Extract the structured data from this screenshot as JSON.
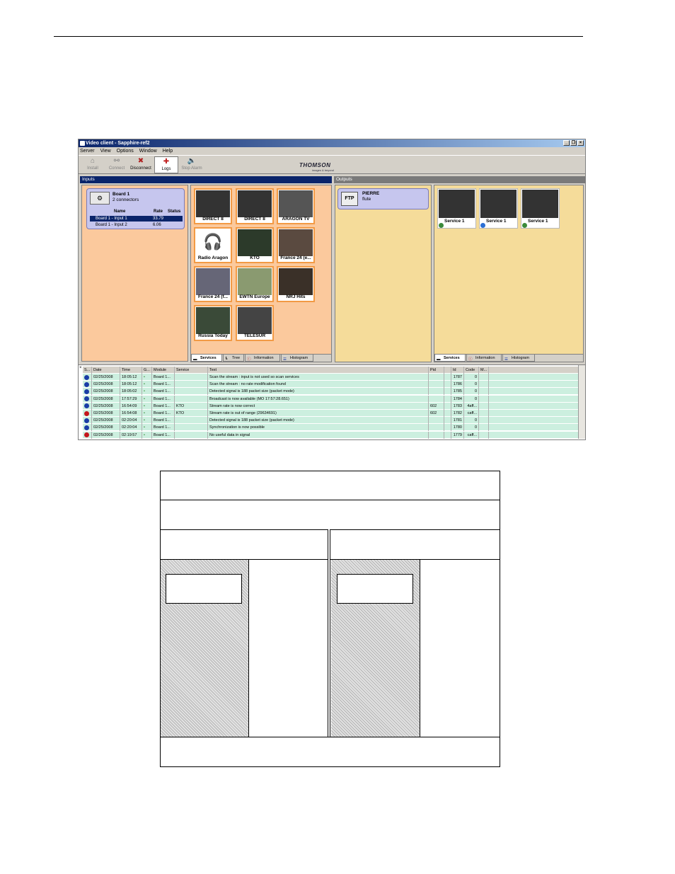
{
  "window": {
    "title": "Video client - Sapphire-ref2",
    "controls": [
      "_",
      "❐",
      "×"
    ]
  },
  "menu": [
    "Server",
    "View",
    "Options",
    "Window",
    "Help"
  ],
  "toolbar": {
    "buttons": [
      {
        "label": "Install",
        "icon": "install-icon",
        "state": "disabled"
      },
      {
        "label": "Connect",
        "icon": "connect-icon",
        "state": "disabled"
      },
      {
        "label": "Disconnect",
        "icon": "disconnect-icon",
        "state": "enabled"
      },
      {
        "label": "Logs",
        "icon": "logs-icon",
        "state": "active"
      },
      {
        "label": "Stop Alarm",
        "icon": "speaker-icon",
        "state": "disabled"
      }
    ],
    "brand": "THOMSON",
    "brand_tagline": "images & beyond"
  },
  "inputs": {
    "header": "Inputs",
    "board": {
      "title": "Board 1",
      "subtitle": "2 connectors",
      "columns": [
        "Name",
        "Rate",
        "Status"
      ],
      "rows": [
        {
          "name": "Board 1 - Input 1",
          "rate": "33.79",
          "status": "",
          "selected": true
        },
        {
          "name": "Board 1 - Input 2",
          "rate": "6.06",
          "status": "",
          "selected": false
        }
      ]
    },
    "services": [
      "DIRECT 8",
      "DIRECT 8",
      "ARAGON TV",
      "Radio Aragon",
      "KTO",
      "France 24 (e...",
      "France 24 (f...",
      "EWTN Europe",
      "NRJ Hits",
      "Russia Today",
      "TELESUR"
    ],
    "tabs": [
      "Services",
      "Tree",
      "Information",
      "Histogram"
    ]
  },
  "outputs": {
    "header": "Outputs",
    "destination": {
      "title": "PIERRE",
      "subtitle": "flute",
      "icon_label": "FTP"
    },
    "services": [
      "Service 1",
      "Service 1",
      "Service 1"
    ],
    "tabs": [
      "Services",
      "Information",
      "Histogram"
    ]
  },
  "logs": {
    "columns": [
      "S...",
      "Date",
      "Time",
      "G...",
      "Module",
      "Service",
      "Text",
      "Pid",
      "",
      "Id",
      "Code",
      "M..."
    ],
    "rows": [
      {
        "sev": "info",
        "date": "02/25/2008",
        "time": "18:05:12",
        "module": "Board 1...",
        "service": "",
        "text": "Scan the stream : input is not used so scan services",
        "pid": "",
        "id": "1787",
        "code": "0"
      },
      {
        "sev": "info",
        "date": "02/25/2008",
        "time": "18:05:12",
        "module": "Board 1...",
        "service": "",
        "text": "Scan the stream : no rate modification found",
        "pid": "",
        "id": "1786",
        "code": "0"
      },
      {
        "sev": "info",
        "date": "02/25/2008",
        "time": "18:05:02",
        "module": "Board 1...",
        "service": "",
        "text": "Detected signal is 188 packet size (packet mode)",
        "pid": "",
        "id": "1785",
        "code": "0"
      },
      {
        "sev": "info",
        "date": "02/25/2008",
        "time": "17:57:29",
        "module": "Board 1...",
        "service": "",
        "text": "Broadcast is now available (MO 17:57:28.651)",
        "pid": "",
        "id": "1784",
        "code": "0"
      },
      {
        "sev": "info",
        "date": "02/25/2008",
        "time": "16:54:09",
        "module": "Board 1...",
        "service": "KTO",
        "text": "Stream rate is now correct",
        "pid": "602",
        "id": "1783",
        "code": "4aff..."
      },
      {
        "sev": "err",
        "date": "02/25/2008",
        "time": "16:54:08",
        "module": "Board 1...",
        "service": "KTO",
        "text": "Stream rate is out of range (29634691)",
        "pid": "602",
        "id": "1782",
        "code": "caff..."
      },
      {
        "sev": "info",
        "date": "02/25/2008",
        "time": "02:20:04",
        "module": "Board 1...",
        "service": "",
        "text": "Detected signal is 188 packet size (packet mode)",
        "pid": "",
        "id": "1781",
        "code": "0"
      },
      {
        "sev": "info",
        "date": "02/25/2008",
        "time": "02:20:04",
        "module": "Board 1...",
        "service": "",
        "text": "Synchronization is now possible",
        "pid": "",
        "id": "1780",
        "code": "0"
      },
      {
        "sev": "err",
        "date": "02/25/2008",
        "time": "02:19:57",
        "module": "Board 1...",
        "service": "",
        "text": "No useful data in signal",
        "pid": "",
        "id": "1779",
        "code": "caff..."
      }
    ]
  },
  "colors": {
    "inputs_bg": "#fbc99d",
    "outputs_bg": "#f5dc9a",
    "log_row_bg": "#ccefdf",
    "selection": "#0a246a"
  }
}
